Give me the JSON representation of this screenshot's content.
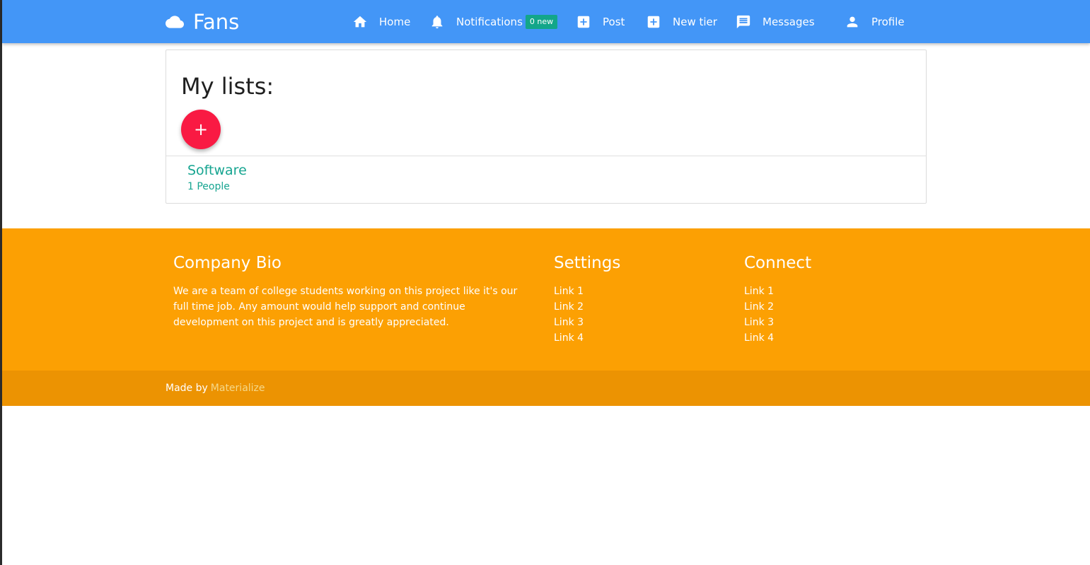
{
  "navbar": {
    "brand": "Fans",
    "background_color": "#4396f7",
    "items": [
      {
        "label": "Home",
        "icon": "home-icon"
      },
      {
        "label": "Notifications",
        "icon": "bell-icon",
        "badge": "0 new"
      },
      {
        "label": "Post",
        "icon": "add-box-icon"
      },
      {
        "label": "New tier",
        "icon": "add-box-icon"
      },
      {
        "label": "Messages",
        "icon": "message-icon"
      },
      {
        "label": "Profile",
        "icon": "person-icon"
      }
    ]
  },
  "main": {
    "title": "My lists:",
    "add_button_label": "+",
    "add_button_color": "#f91a43",
    "lists": [
      {
        "name": "Software",
        "count": "1 People"
      }
    ],
    "link_color": "#17a591"
  },
  "footer": {
    "background_color": "#fca003",
    "bio": {
      "title": "Company Bio",
      "text": "We are a team of college students working on this project like it's our full time job. Any amount would help support and continue development on this project and is greatly appreciated."
    },
    "settings": {
      "title": "Settings",
      "links": [
        "Link 1",
        "Link 2",
        "Link 3",
        "Link 4"
      ]
    },
    "connect": {
      "title": "Connect",
      "links": [
        "Link 1",
        "Link 2",
        "Link 3",
        "Link 4"
      ]
    },
    "copyright": {
      "text": "Made by",
      "link": "Materialize"
    }
  }
}
